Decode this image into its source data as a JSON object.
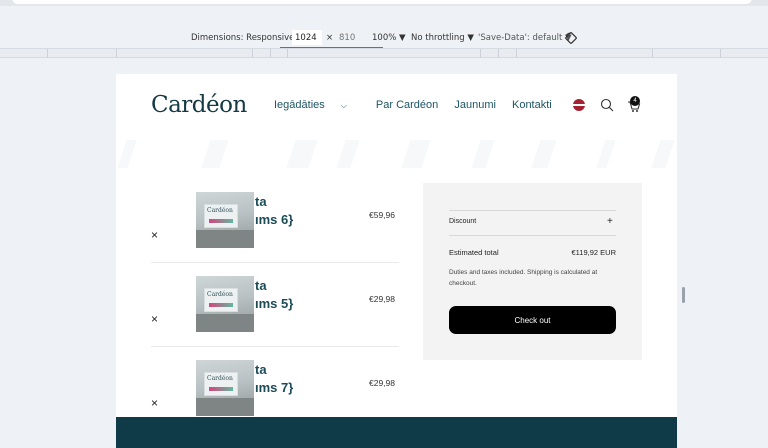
{
  "devtools": {
    "dimensions_label": "Dimensions: Responsive",
    "width_value": "1024",
    "times": "×",
    "height_placeholder": "810",
    "zoom": "100%",
    "throttling": "No throttling",
    "save_data": "'Save-Data': default"
  },
  "site": {
    "logo": "Cardéon",
    "nav": [
      "Iegādāties",
      "Par Cardéon",
      "Jaunumi",
      "Kontakti"
    ],
    "cart_count": "4"
  },
  "cart": {
    "items": [
      {
        "name_line1": "ta",
        "name_line2": "ıms 6}",
        "price": "€59,96",
        "thumb_label": "Cardéon"
      },
      {
        "name_line1": "ta",
        "name_line2": "ıms 5}",
        "price": "€29,98",
        "thumb_label": "Cardéon"
      },
      {
        "name_line1": "ta",
        "name_line2": "ıms 7}",
        "price": "€29,98",
        "thumb_label": "Cardéon"
      }
    ],
    "remove_symbol": "×"
  },
  "summary": {
    "discount_label": "Discount",
    "discount_toggle": "+",
    "estimated_label": "Estimated total",
    "estimated_value": "€119,92 EUR",
    "duties_text": "Duties and taxes included. Shipping is calculated at checkout.",
    "checkout_label": "Check out"
  },
  "colors": {
    "brand": "#153a44",
    "nav": "#1d5564",
    "footer": "#0f3a48",
    "checkout": "#000000"
  }
}
